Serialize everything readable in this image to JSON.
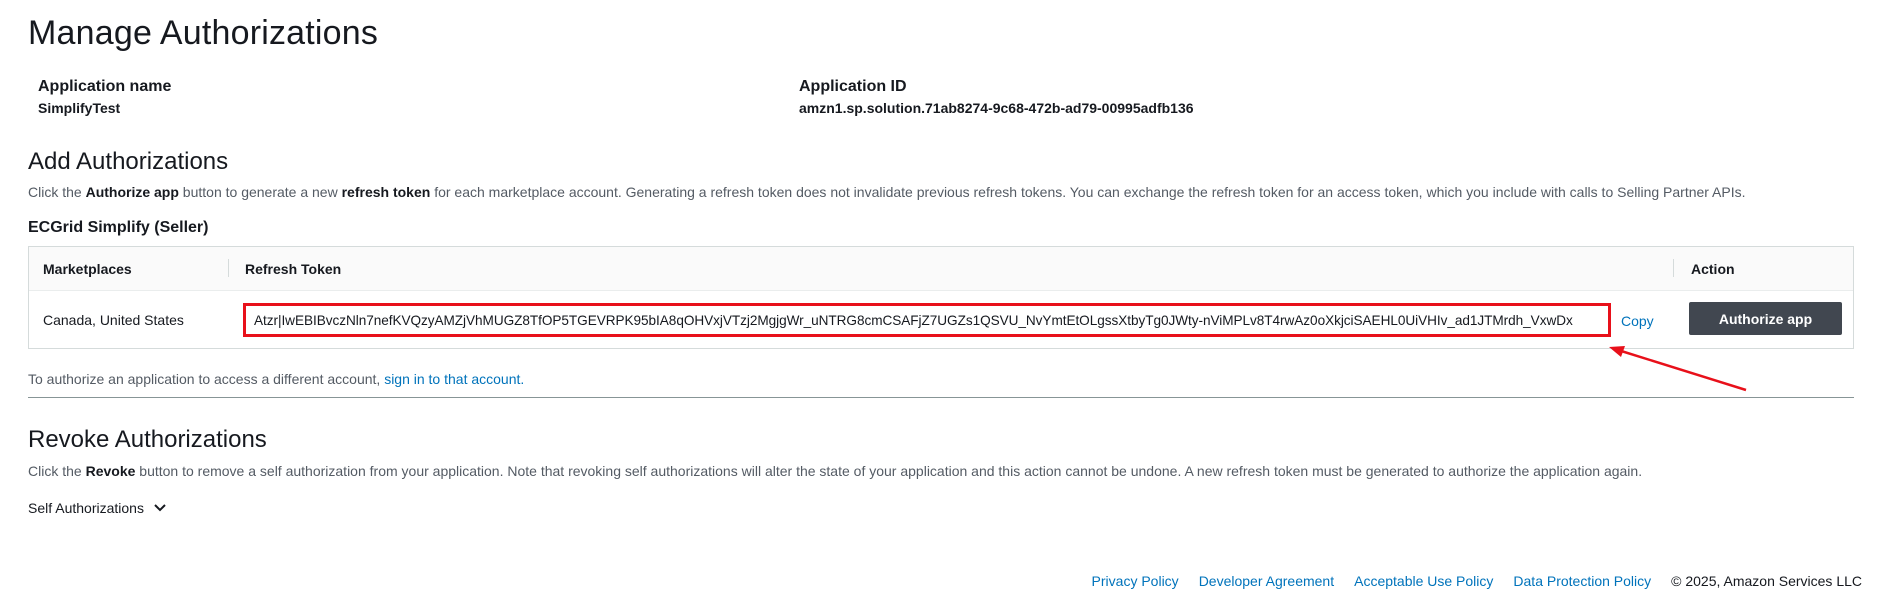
{
  "page": {
    "title": "Manage Authorizations"
  },
  "app_info": {
    "name_label": "Application name",
    "name_value": "SimplifyTest",
    "id_label": "Application ID",
    "id_value": "amzn1.sp.solution.71ab8274-9c68-472b-ad79-00995adfb136"
  },
  "add_section": {
    "title": "Add Authorizations",
    "desc_part1": "Click the ",
    "desc_bold1": "Authorize app",
    "desc_part2": " button to generate a new ",
    "desc_bold2": "refresh token",
    "desc_part3": " for each marketplace account. Generating a refresh token does not invalidate previous refresh tokens. You can exchange the refresh token for an access token, which you include with calls to Selling Partner APIs.",
    "seller_title": "ECGrid Simplify (Seller)",
    "table": {
      "headers": {
        "marketplaces": "Marketplaces",
        "refresh_token": "Refresh Token",
        "action": "Action"
      },
      "row": {
        "marketplaces": "Canada, United States",
        "refresh_token": "Atzr|IwEBIBvczNln7nefKVQzyAMZjVhMUGZ8TfOP5TGEVRPK95bIA8qOHVxjVTzj2MgjgWr_uNTRG8cmCSAFjZ7UGZs1QSVU_NvYmtEtOLgssXtbyTg0JWty-nViMPLv8T4rwAz0oXkjciSAEHL0UiVHIv_ad1JTMrdh_VxwDx",
        "copy_label": "Copy",
        "authorize_label": "Authorize app"
      }
    },
    "note_text": "To authorize an application to access a different account, ",
    "note_link": "sign in to that account."
  },
  "revoke_section": {
    "title": "Revoke Authorizations",
    "desc_part1": "Click the ",
    "desc_bold1": "Revoke",
    "desc_part2": " button to remove a self authorization from your application. Note that revoking self authorizations will alter the state of your application and this action cannot be undone. A new refresh token must be generated to authorize the application again.",
    "self_auth_label": "Self Authorizations"
  },
  "footer": {
    "links": [
      "Privacy Policy",
      "Developer Agreement",
      "Acceptable Use Policy",
      "Data Protection Policy"
    ],
    "copyright": "© 2025, Amazon Services LLC"
  },
  "colors": {
    "link": "#0073bb",
    "button": "#414750",
    "highlight": "#e8101a"
  },
  "icons": {
    "expand": "chevron-down-icon",
    "annotation": "red-arrow-annotation"
  }
}
